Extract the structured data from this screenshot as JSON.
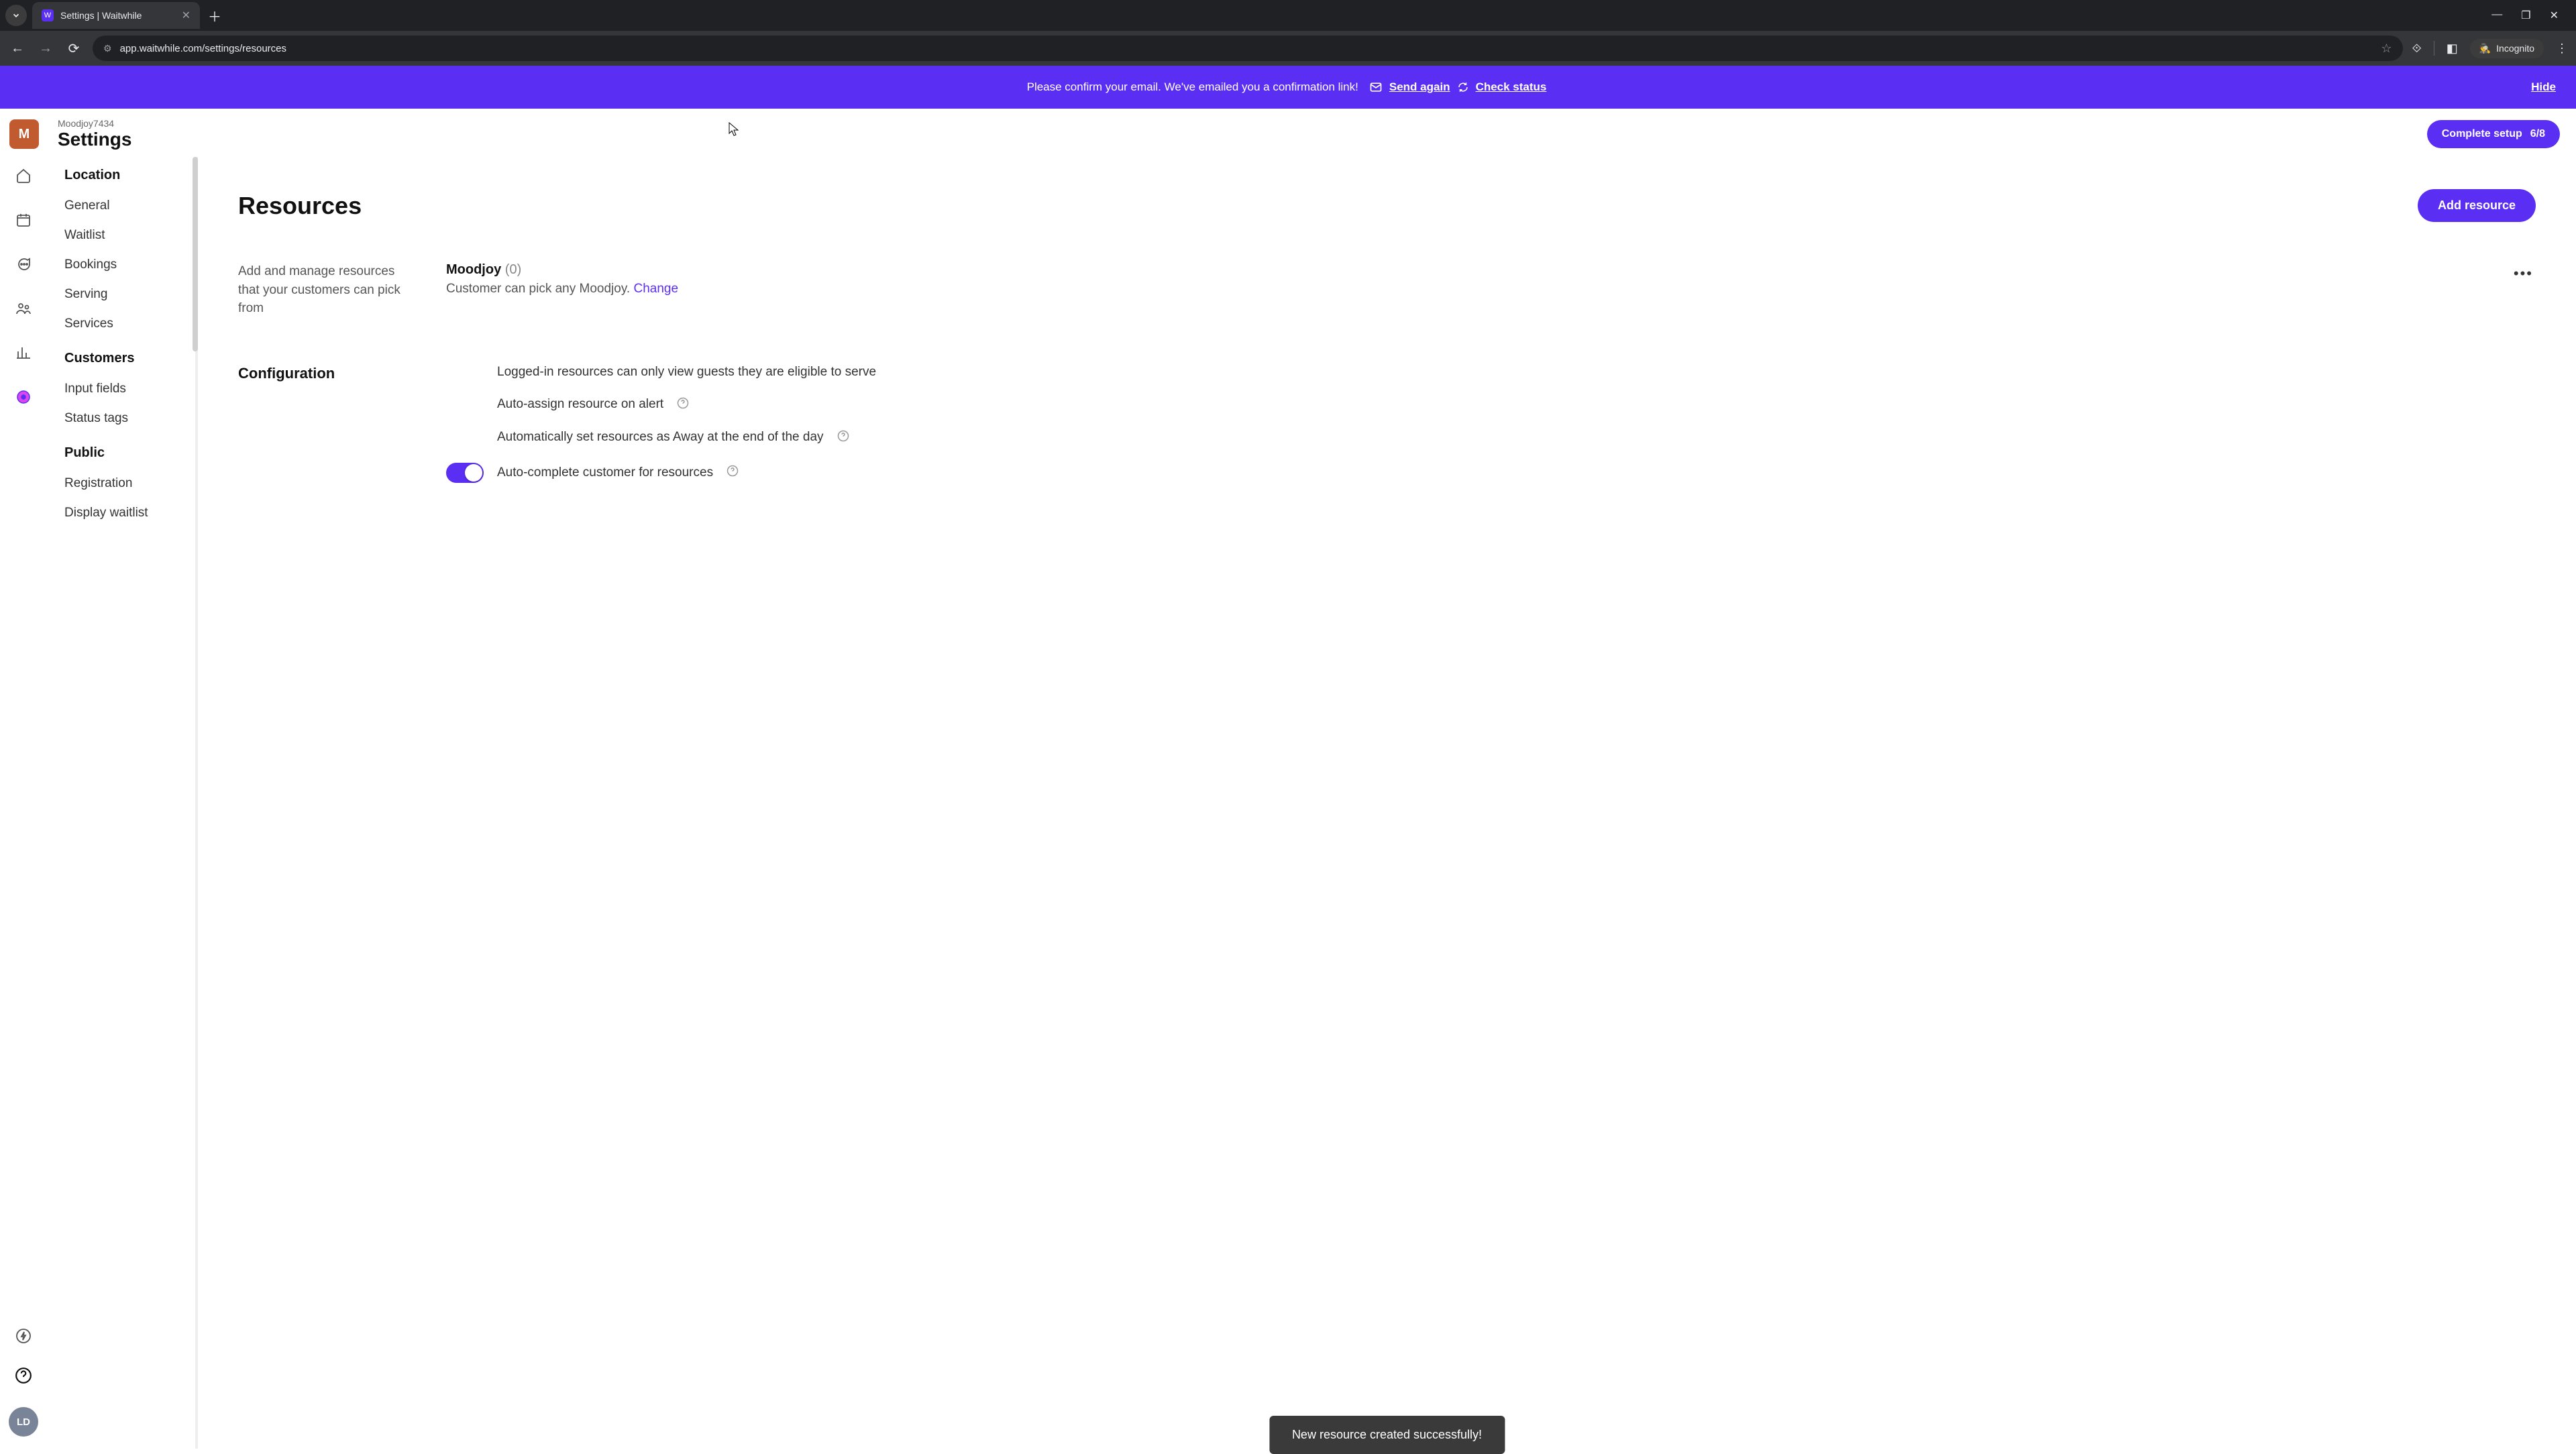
{
  "browser": {
    "tab_title": "Settings | Waitwhile",
    "url": "app.waitwhile.com/settings/resources",
    "incognito_label": "Incognito"
  },
  "banner": {
    "text": "Please confirm your email. We've emailed you a confirmation link!",
    "send_again": "Send again",
    "check_status": "Check status",
    "hide": "Hide"
  },
  "header": {
    "org_initial": "M",
    "org_name": "Moodjoy7434",
    "page_title": "Settings",
    "complete_setup_label": "Complete setup",
    "complete_setup_count": "6/8"
  },
  "nav": {
    "section1_heading": "Location",
    "section1_items": [
      "General",
      "Waitlist",
      "Bookings",
      "Serving",
      "Services"
    ],
    "section2_heading": "Customers",
    "section2_items": [
      "Input fields",
      "Status tags"
    ],
    "section3_heading": "Public",
    "section3_items": [
      "Registration",
      "Display waitlist"
    ]
  },
  "user_avatar": "LD",
  "content": {
    "title": "Resources",
    "add_button": "Add resource",
    "section_desc": "Add and manage resources that your customers can pick from",
    "resource": {
      "name": "Moodjoy",
      "count": "(0)",
      "subtitle": "Customer can pick any Moodjoy.",
      "change": "Change"
    },
    "config_title": "Configuration",
    "config_items": [
      {
        "label": "Logged-in resources can only view guests they are eligible to serve",
        "help": false,
        "toggle": null
      },
      {
        "label": "Auto-assign resource on alert",
        "help": true,
        "toggle": null
      },
      {
        "label": "Automatically set resources as Away at the end of the day",
        "help": true,
        "toggle": null
      },
      {
        "label": "Auto-complete customer for resources",
        "help": true,
        "toggle": true
      }
    ]
  },
  "toast": "New resource created successfully!"
}
